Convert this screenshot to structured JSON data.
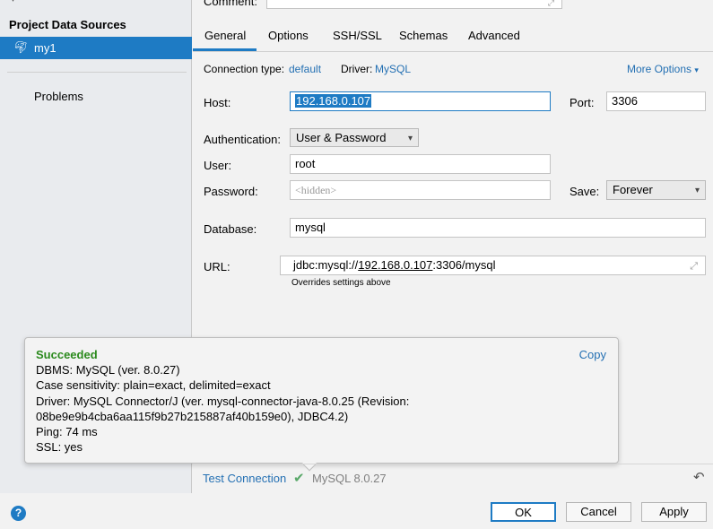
{
  "sidebar": {
    "title": "Project Data Sources",
    "items": [
      {
        "label": "my1",
        "icon": "mysql-dolphin-icon",
        "selected": true
      }
    ],
    "problems": "Problems"
  },
  "form": {
    "comment_label": "Comment:",
    "tabs": [
      {
        "label": "General",
        "active": true
      },
      {
        "label": "Options"
      },
      {
        "label": "SSH/SSL"
      },
      {
        "label": "Schemas"
      },
      {
        "label": "Advanced"
      }
    ],
    "connection_type_label": "Connection type:",
    "connection_type": "default",
    "driver_label": "Driver:",
    "driver": "MySQL",
    "more_options": "More Options",
    "host_label": "Host:",
    "host": "192.168.0.107",
    "port_label": "Port:",
    "port": "3306",
    "auth_label": "Authentication:",
    "auth": "User & Password",
    "user_label": "User:",
    "user": "root",
    "password_label": "Password:",
    "password_placeholder": "<hidden>",
    "save_label": "Save:",
    "save": "Forever",
    "database_label": "Database:",
    "database": "mysql",
    "url_label": "URL:",
    "url_prefix": "jdbc:mysql://",
    "url_host": "192.168.0.107",
    "url_suffix": ":3306/mysql",
    "url_hint": "Overrides settings above"
  },
  "popup": {
    "status": "Succeeded",
    "copy": "Copy",
    "lines": [
      "DBMS: MySQL (ver. 8.0.27)",
      "Case sensitivity: plain=exact, delimited=exact",
      "Driver: MySQL Connector/J (ver. mysql-connector-java-8.0.25 (Revision:",
      "08be9e9b4cba6aa115f9b27b215887af40b159e0), JDBC4.2)",
      "Ping: 74 ms",
      "SSL: yes"
    ]
  },
  "bottom": {
    "test_connection": "Test Connection",
    "version": "MySQL 8.0.27"
  },
  "footer": {
    "ok": "OK",
    "cancel": "Cancel",
    "apply": "Apply"
  },
  "colors": {
    "accent": "#1e7bc4",
    "link": "#2470b3",
    "success": "#2b8a1d"
  }
}
